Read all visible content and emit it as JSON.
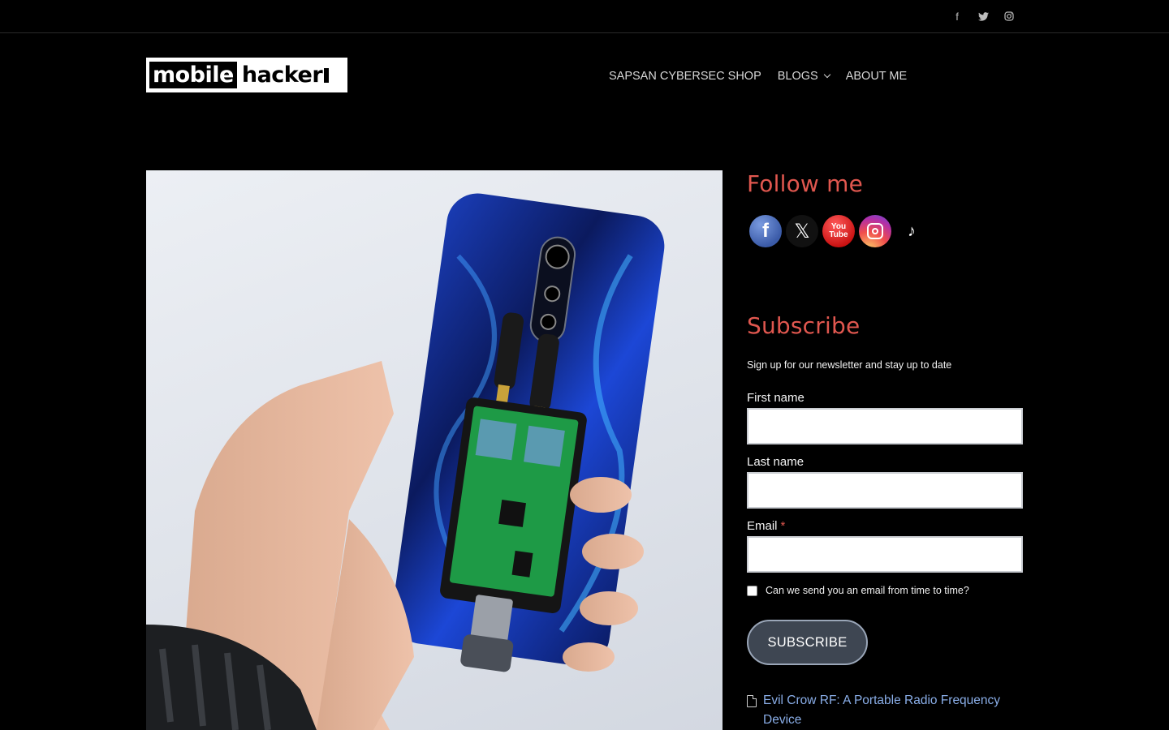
{
  "topbar": {
    "social": [
      {
        "icon": "facebook-icon",
        "glyph": "f"
      },
      {
        "icon": "twitter-icon",
        "glyph": "🐦"
      },
      {
        "icon": "instagram-icon",
        "glyph": "◎"
      }
    ]
  },
  "header": {
    "logo": {
      "part1": "mobile",
      "part2": "hacker"
    },
    "nav": [
      {
        "label": "SAPSAN CYBERSEC SHOP"
      },
      {
        "label": "BLOGS"
      },
      {
        "label": "ABOUT ME"
      }
    ]
  },
  "sidebar": {
    "follow": {
      "title": "Follow me",
      "icons": [
        {
          "name": "facebook-follow-icon",
          "glyph": "f"
        },
        {
          "name": "x-follow-icon",
          "glyph": "𝕏"
        },
        {
          "name": "youtube-follow-icon",
          "line1": "You",
          "line2": "Tube"
        },
        {
          "name": "instagram-follow-icon"
        },
        {
          "name": "tiktok-follow-icon",
          "glyph": "♪"
        }
      ]
    },
    "subscribe": {
      "title": "Subscribe",
      "description": "Sign up for our newsletter and stay up to date",
      "first_name_label": "First name",
      "last_name_label": "Last name",
      "email_label": "Email",
      "required_mark": "*",
      "consent_label": "Can we send you an email from time to time?",
      "button_label": "SUBSCRIBE"
    },
    "recent_post": "Evil Crow RF: A Portable Radio Frequency Device"
  },
  "colors": {
    "accent": "#e0574f",
    "link": "#8aaee8",
    "background": "#000000"
  }
}
